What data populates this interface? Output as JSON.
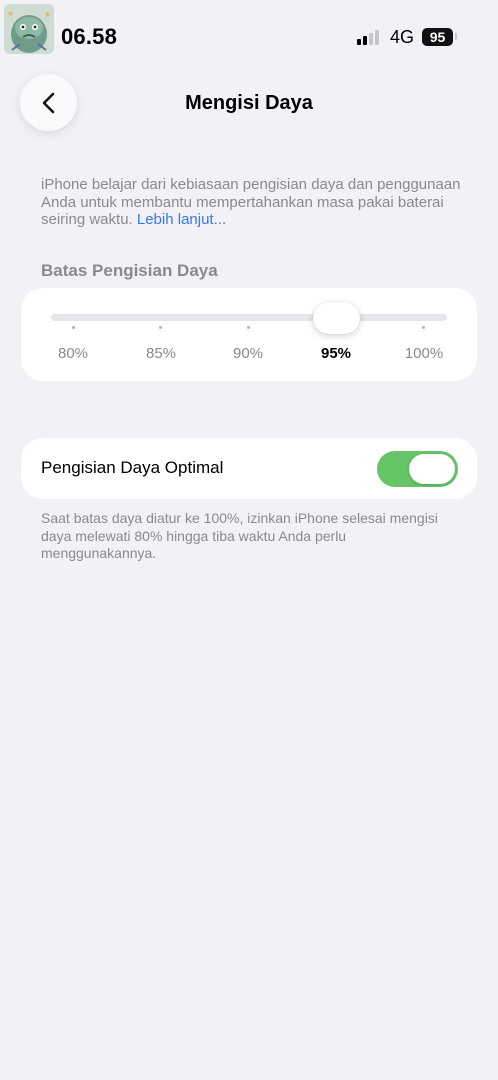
{
  "status_bar": {
    "time": "06.58",
    "network": "4G",
    "battery_level": "95",
    "signal_bars_active": 2,
    "signal_bars_total": 4
  },
  "nav": {
    "title": "Mengisi Daya"
  },
  "description": {
    "text": "iPhone belajar dari kebiasaan pengisian daya dan penggunaan Anda untuk membantu mempertahankan masa pakai baterai seiring waktu. ",
    "link": "Lebih lanjut..."
  },
  "charge_limit": {
    "header": "Batas Pengisian Daya",
    "options": [
      "80%",
      "85%",
      "90%",
      "95%",
      "100%"
    ],
    "selected": "95%"
  },
  "optimized_charging": {
    "label": "Pengisian Daya Optimal",
    "enabled": true
  },
  "footnote": "Saat batas daya diatur ke 100%, izinkan iPhone selesai mengisi daya melewati 80% hingga tiba waktu Anda perlu menggunakannya.",
  "colors": {
    "background": "#f2f1f6",
    "accent_link": "#3478f6",
    "toggle_on": "#65c466",
    "secondary_text": "#8a8a8e"
  },
  "icons": {
    "back": "chevron-left-icon",
    "signal": "cellular-signal-icon",
    "battery": "battery-icon"
  }
}
